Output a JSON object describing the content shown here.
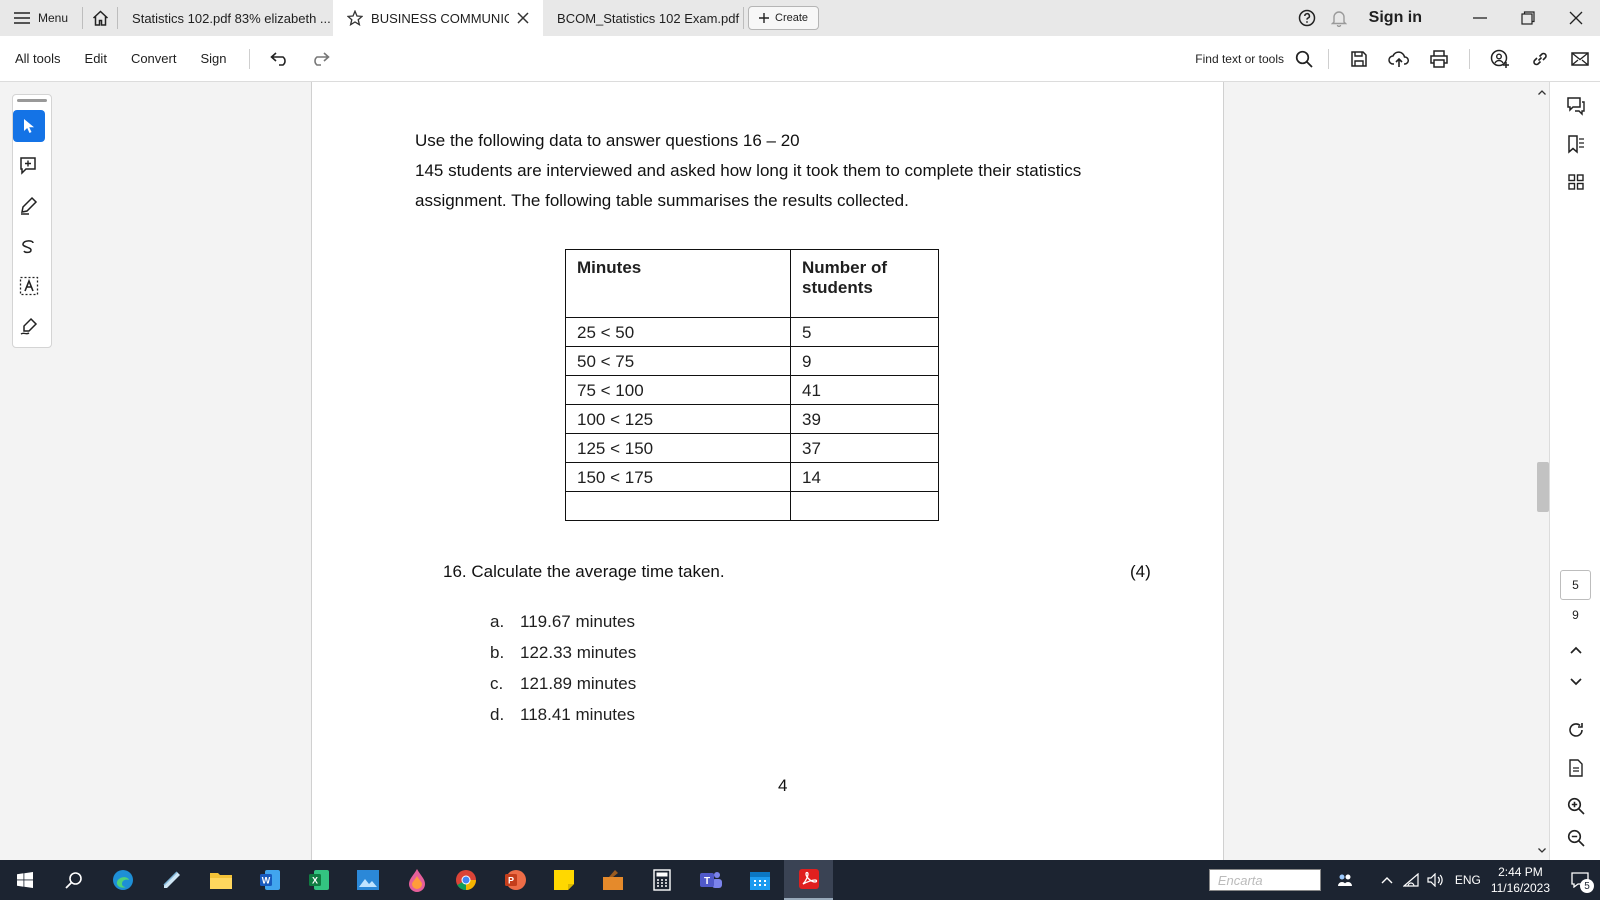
{
  "tabbar": {
    "menu_label": "Menu",
    "tabs": [
      {
        "label": "Statistics 102.pdf 83% elizabeth ..."
      },
      {
        "label": "BUSINESS COMMUNIC..."
      },
      {
        "label": "BCOM_Statistics 102 Exam.pdf"
      }
    ],
    "create_label": "Create",
    "sign_in": "Sign in"
  },
  "toolbar": {
    "items": [
      "All tools",
      "Edit",
      "Convert",
      "Sign"
    ],
    "find_label": "Find text or tools"
  },
  "document": {
    "intro_line1": "Use the following data to answer questions 16 – 20",
    "intro_line2": "145 students are interviewed and asked how long it took them to complete their statistics",
    "intro_line3": "assignment. The following table summarises the results collected.",
    "table": {
      "headers": [
        "Minutes",
        "Number of students"
      ],
      "rows": [
        [
          "25 < 50",
          "5"
        ],
        [
          "50 < 75",
          "9"
        ],
        [
          "75 < 100",
          "41"
        ],
        [
          "100 < 125",
          "39"
        ],
        [
          "125 < 150",
          "37"
        ],
        [
          "150 < 175",
          "14"
        ],
        [
          "",
          ""
        ]
      ]
    },
    "question": "16. Calculate the average time taken.",
    "marks": "(4)",
    "options": [
      {
        "letter": "a.",
        "text": "119.67 minutes"
      },
      {
        "letter": "b.",
        "text": "122.33 minutes"
      },
      {
        "letter": "c.",
        "text": "121.89 minutes"
      },
      {
        "letter": "d.",
        "text": "118.41 minutes"
      }
    ],
    "page_number": "4"
  },
  "page_nav": {
    "current": "5",
    "total": "9"
  },
  "taskbar": {
    "search_box": "Encarta",
    "language": "ENG",
    "time": "2:44 PM",
    "date": "11/16/2023",
    "notifications": "5"
  }
}
